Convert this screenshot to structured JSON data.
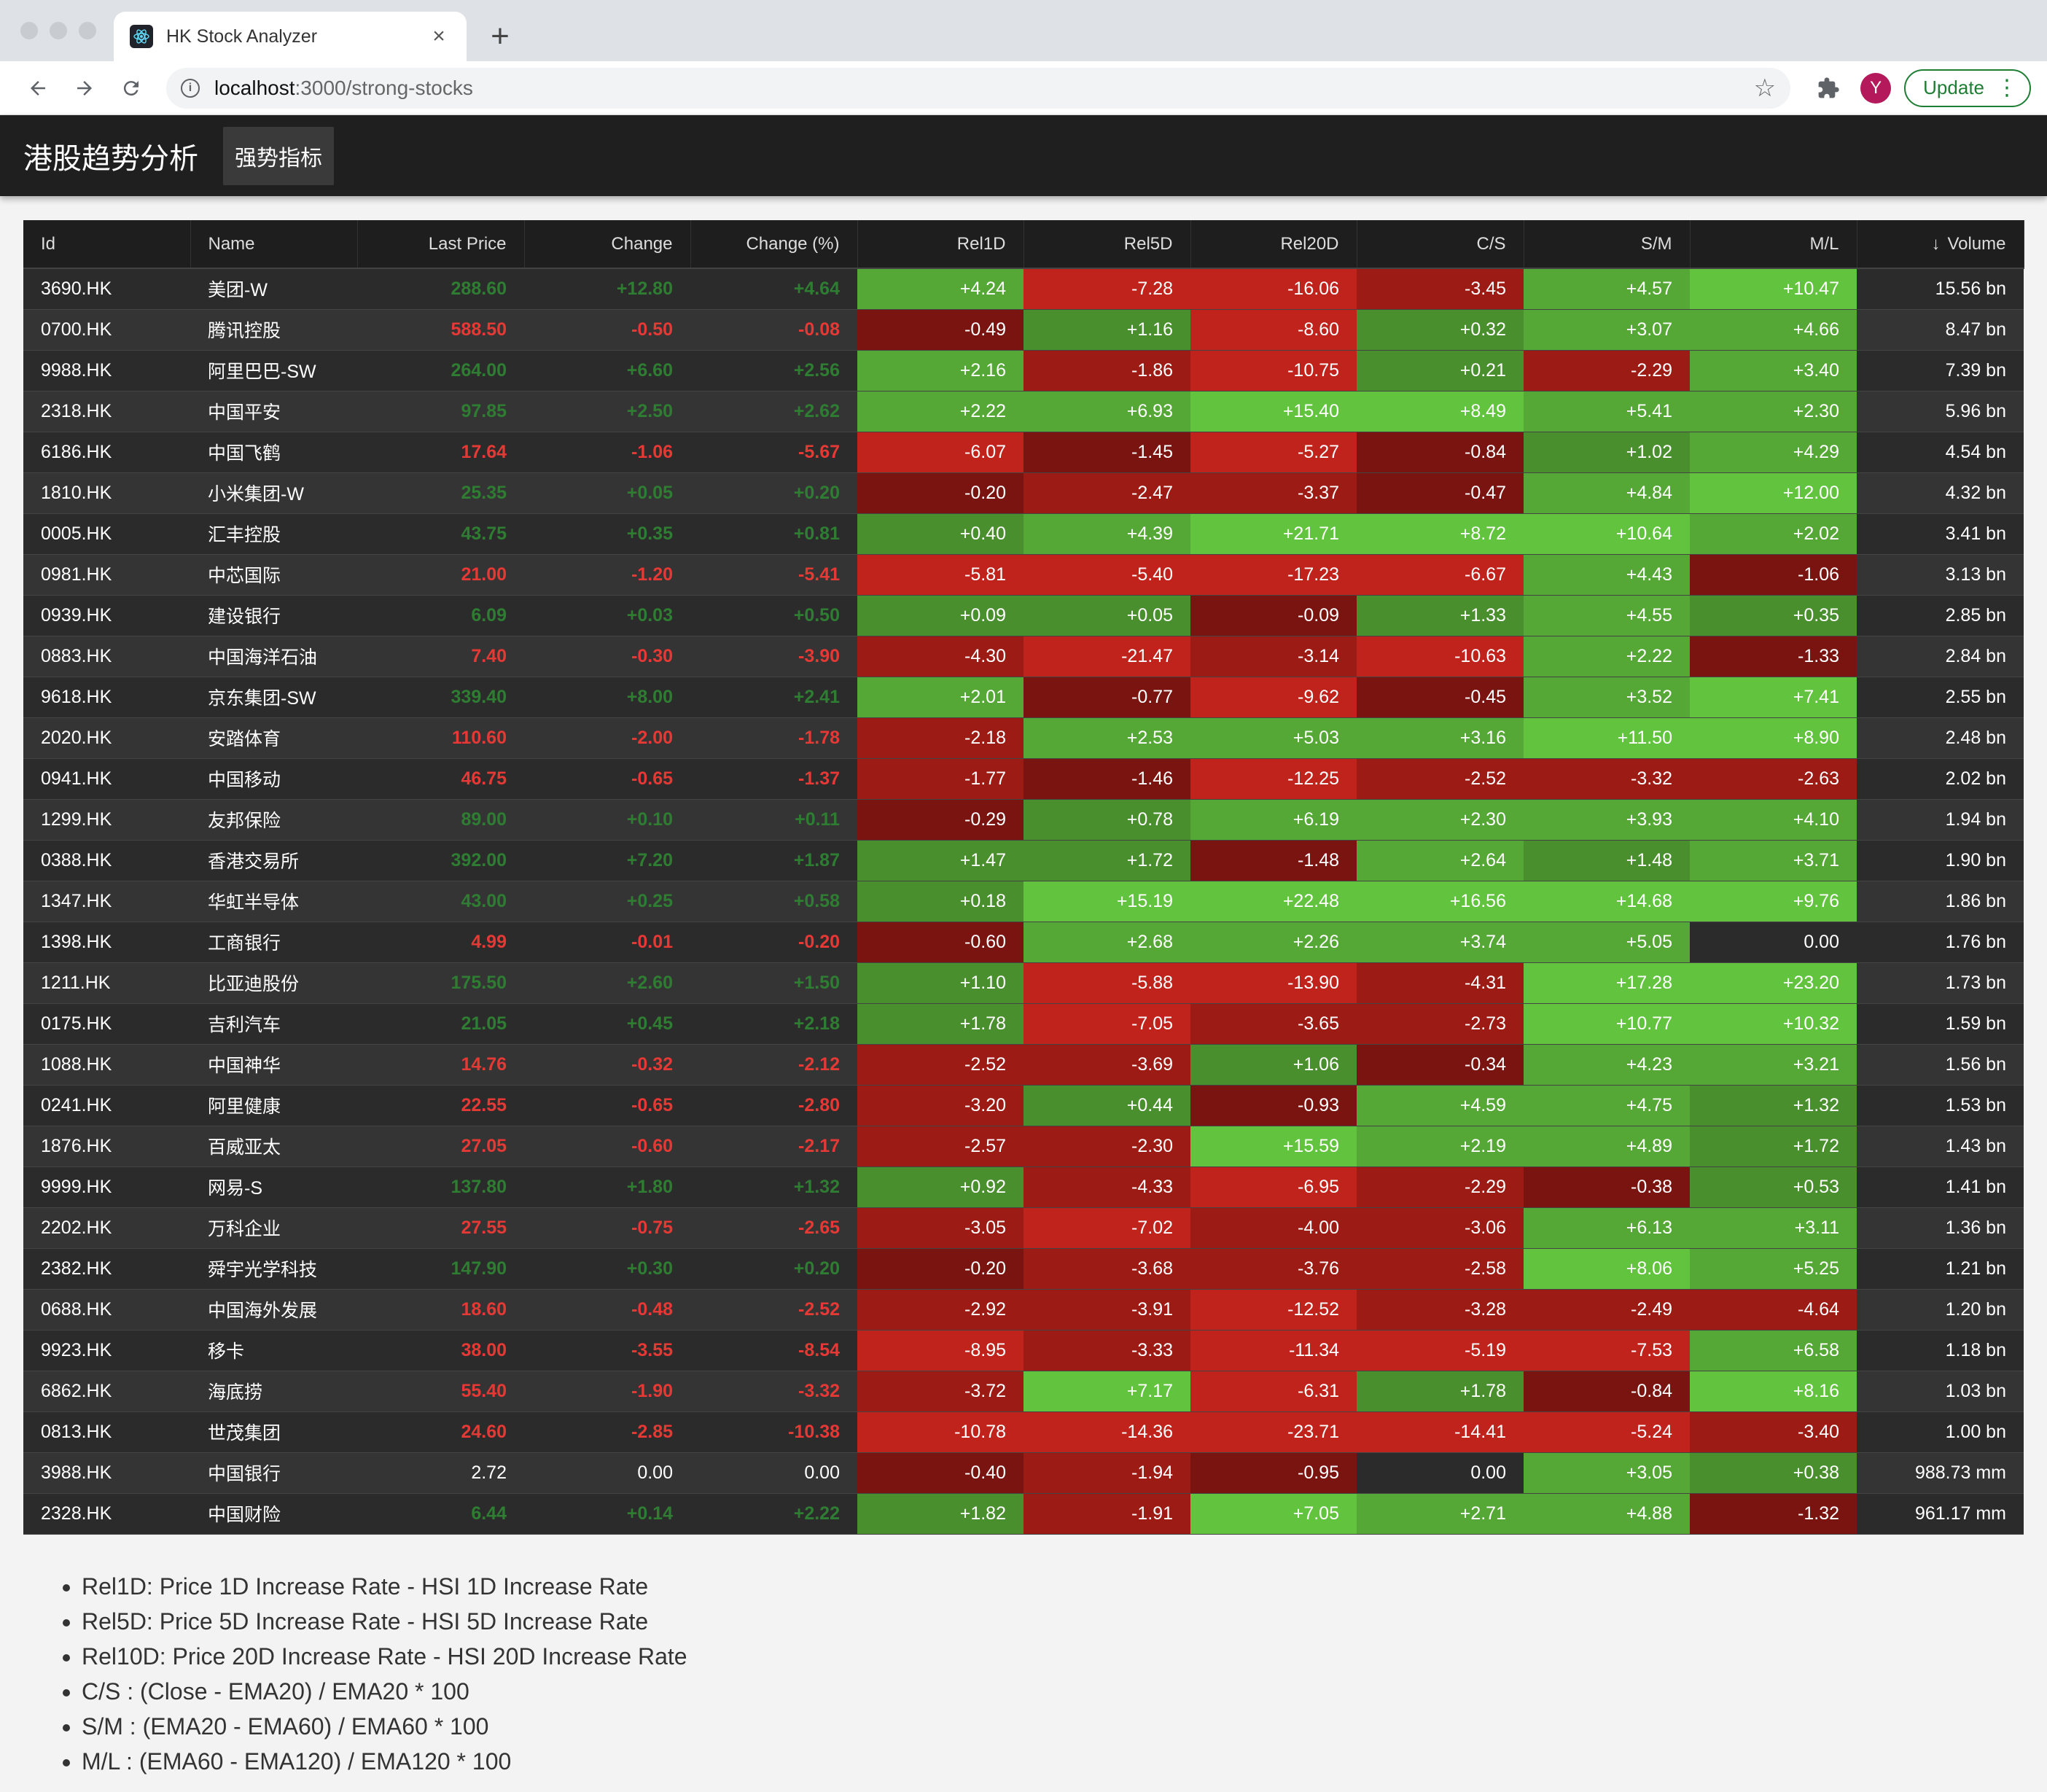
{
  "browser": {
    "tab_title": "HK Stock Analyzer",
    "url_host": "localhost",
    "url_path": ":3000/strong-stocks",
    "avatar_letter": "Y",
    "update_label": "Update"
  },
  "app": {
    "title": "港股趋势分析",
    "nav_label": "强势指标"
  },
  "table": {
    "columns": [
      "Id",
      "Name",
      "Last Price",
      "Change",
      "Change (%)",
      "Rel1D",
      "Rel5D",
      "Rel20D",
      "C/S",
      "S/M",
      "M/L",
      "Volume"
    ],
    "rows": [
      [
        "3690.HK",
        "美团-W",
        "288.60",
        "+12.80",
        "+4.64",
        "+4.24",
        "-7.28",
        "-16.06",
        "-3.45",
        "+4.57",
        "+10.47",
        "15.56 bn"
      ],
      [
        "0700.HK",
        "腾讯控股",
        "588.50",
        "-0.50",
        "-0.08",
        "-0.49",
        "+1.16",
        "-8.60",
        "+0.32",
        "+3.07",
        "+4.66",
        "8.47 bn"
      ],
      [
        "9988.HK",
        "阿里巴巴-SW",
        "264.00",
        "+6.60",
        "+2.56",
        "+2.16",
        "-1.86",
        "-10.75",
        "+0.21",
        "-2.29",
        "+3.40",
        "7.39 bn"
      ],
      [
        "2318.HK",
        "中国平安",
        "97.85",
        "+2.50",
        "+2.62",
        "+2.22",
        "+6.93",
        "+15.40",
        "+8.49",
        "+5.41",
        "+2.30",
        "5.96 bn"
      ],
      [
        "6186.HK",
        "中国飞鹤",
        "17.64",
        "-1.06",
        "-5.67",
        "-6.07",
        "-1.45",
        "-5.27",
        "-0.84",
        "+1.02",
        "+4.29",
        "4.54 bn"
      ],
      [
        "1810.HK",
        "小米集团-W",
        "25.35",
        "+0.05",
        "+0.20",
        "-0.20",
        "-2.47",
        "-3.37",
        "-0.47",
        "+4.84",
        "+12.00",
        "4.32 bn"
      ],
      [
        "0005.HK",
        "汇丰控股",
        "43.75",
        "+0.35",
        "+0.81",
        "+0.40",
        "+4.39",
        "+21.71",
        "+8.72",
        "+10.64",
        "+2.02",
        "3.41 bn"
      ],
      [
        "0981.HK",
        "中芯国际",
        "21.00",
        "-1.20",
        "-5.41",
        "-5.81",
        "-5.40",
        "-17.23",
        "-6.67",
        "+4.43",
        "-1.06",
        "3.13 bn"
      ],
      [
        "0939.HK",
        "建设银行",
        "6.09",
        "+0.03",
        "+0.50",
        "+0.09",
        "+0.05",
        "-0.09",
        "+1.33",
        "+4.55",
        "+0.35",
        "2.85 bn"
      ],
      [
        "0883.HK",
        "中国海洋石油",
        "7.40",
        "-0.30",
        "-3.90",
        "-4.30",
        "-21.47",
        "-3.14",
        "-10.63",
        "+2.22",
        "-1.33",
        "2.84 bn"
      ],
      [
        "9618.HK",
        "京东集团-SW",
        "339.40",
        "+8.00",
        "+2.41",
        "+2.01",
        "-0.77",
        "-9.62",
        "-0.45",
        "+3.52",
        "+7.41",
        "2.55 bn"
      ],
      [
        "2020.HK",
        "安踏体育",
        "110.60",
        "-2.00",
        "-1.78",
        "-2.18",
        "+2.53",
        "+5.03",
        "+3.16",
        "+11.50",
        "+8.90",
        "2.48 bn"
      ],
      [
        "0941.HK",
        "中国移动",
        "46.75",
        "-0.65",
        "-1.37",
        "-1.77",
        "-1.46",
        "-12.25",
        "-2.52",
        "-3.32",
        "-2.63",
        "2.02 bn"
      ],
      [
        "1299.HK",
        "友邦保险",
        "89.00",
        "+0.10",
        "+0.11",
        "-0.29",
        "+0.78",
        "+6.19",
        "+2.30",
        "+3.93",
        "+4.10",
        "1.94 bn"
      ],
      [
        "0388.HK",
        "香港交易所",
        "392.00",
        "+7.20",
        "+1.87",
        "+1.47",
        "+1.72",
        "-1.48",
        "+2.64",
        "+1.48",
        "+3.71",
        "1.90 bn"
      ],
      [
        "1347.HK",
        "华虹半导体",
        "43.00",
        "+0.25",
        "+0.58",
        "+0.18",
        "+15.19",
        "+22.48",
        "+16.56",
        "+14.68",
        "+9.76",
        "1.86 bn"
      ],
      [
        "1398.HK",
        "工商银行",
        "4.99",
        "-0.01",
        "-0.20",
        "-0.60",
        "+2.68",
        "+2.26",
        "+3.74",
        "+5.05",
        "0.00",
        "1.76 bn"
      ],
      [
        "1211.HK",
        "比亚迪股份",
        "175.50",
        "+2.60",
        "+1.50",
        "+1.10",
        "-5.88",
        "-13.90",
        "-4.31",
        "+17.28",
        "+23.20",
        "1.73 bn"
      ],
      [
        "0175.HK",
        "吉利汽车",
        "21.05",
        "+0.45",
        "+2.18",
        "+1.78",
        "-7.05",
        "-3.65",
        "-2.73",
        "+10.77",
        "+10.32",
        "1.59 bn"
      ],
      [
        "1088.HK",
        "中国神华",
        "14.76",
        "-0.32",
        "-2.12",
        "-2.52",
        "-3.69",
        "+1.06",
        "-0.34",
        "+4.23",
        "+3.21",
        "1.56 bn"
      ],
      [
        "0241.HK",
        "阿里健康",
        "22.55",
        "-0.65",
        "-2.80",
        "-3.20",
        "+0.44",
        "-0.93",
        "+4.59",
        "+4.75",
        "+1.32",
        "1.53 bn"
      ],
      [
        "1876.HK",
        "百威亚太",
        "27.05",
        "-0.60",
        "-2.17",
        "-2.57",
        "-2.30",
        "+15.59",
        "+2.19",
        "+4.89",
        "+1.72",
        "1.43 bn"
      ],
      [
        "9999.HK",
        "网易-S",
        "137.80",
        "+1.80",
        "+1.32",
        "+0.92",
        "-4.33",
        "-6.95",
        "-2.29",
        "-0.38",
        "+0.53",
        "1.41 bn"
      ],
      [
        "2202.HK",
        "万科企业",
        "27.55",
        "-0.75",
        "-2.65",
        "-3.05",
        "-7.02",
        "-4.00",
        "-3.06",
        "+6.13",
        "+3.11",
        "1.36 bn"
      ],
      [
        "2382.HK",
        "舜宇光学科技",
        "147.90",
        "+0.30",
        "+0.20",
        "-0.20",
        "-3.68",
        "-3.76",
        "-2.58",
        "+8.06",
        "+5.25",
        "1.21 bn"
      ],
      [
        "0688.HK",
        "中国海外发展",
        "18.60",
        "-0.48",
        "-2.52",
        "-2.92",
        "-3.91",
        "-12.52",
        "-3.28",
        "-2.49",
        "-4.64",
        "1.20 bn"
      ],
      [
        "9923.HK",
        "移卡",
        "38.00",
        "-3.55",
        "-8.54",
        "-8.95",
        "-3.33",
        "-11.34",
        "-5.19",
        "-7.53",
        "+6.58",
        "1.18 bn"
      ],
      [
        "6862.HK",
        "海底捞",
        "55.40",
        "-1.90",
        "-3.32",
        "-3.72",
        "+7.17",
        "-6.31",
        "+1.78",
        "-0.84",
        "+8.16",
        "1.03 bn"
      ],
      [
        "0813.HK",
        "世茂集团",
        "24.60",
        "-2.85",
        "-10.38",
        "-10.78",
        "-14.36",
        "-23.71",
        "-14.41",
        "-5.24",
        "-3.40",
        "1.00 bn"
      ],
      [
        "3988.HK",
        "中国银行",
        "2.72",
        "0.00",
        "0.00",
        "-0.40",
        "-1.94",
        "-0.95",
        "0.00",
        "+3.05",
        "+0.38",
        "988.73 mm"
      ],
      [
        "2328.HK",
        "中国财险",
        "6.44",
        "+0.14",
        "+2.22",
        "+1.82",
        "-1.91",
        "+7.05",
        "+2.71",
        "+4.88",
        "-1.32",
        "961.17 mm"
      ]
    ]
  },
  "notes": [
    "Rel1D: Price 1D Increase Rate - HSI 1D Increase Rate",
    "Rel5D: Price 5D Increase Rate - HSI 5D Increase Rate",
    "Rel10D: Price 20D Increase Rate - HSI 20D Increase Rate",
    "C/S : (Close - EMA20) / EMA20 * 100",
    "S/M : (EMA20 - EMA60) / EMA60 * 100",
    "M/L : (EMA60 - EMA120) / EMA120 * 100"
  ],
  "colors": {
    "green_1": "#4a8f2e",
    "green_2": "#55a836",
    "green_3": "#62c43e",
    "red_1": "#7a1410",
    "red_2": "#9c1b14",
    "red_3": "#c0231c",
    "neutral": "#2b2b2b"
  }
}
